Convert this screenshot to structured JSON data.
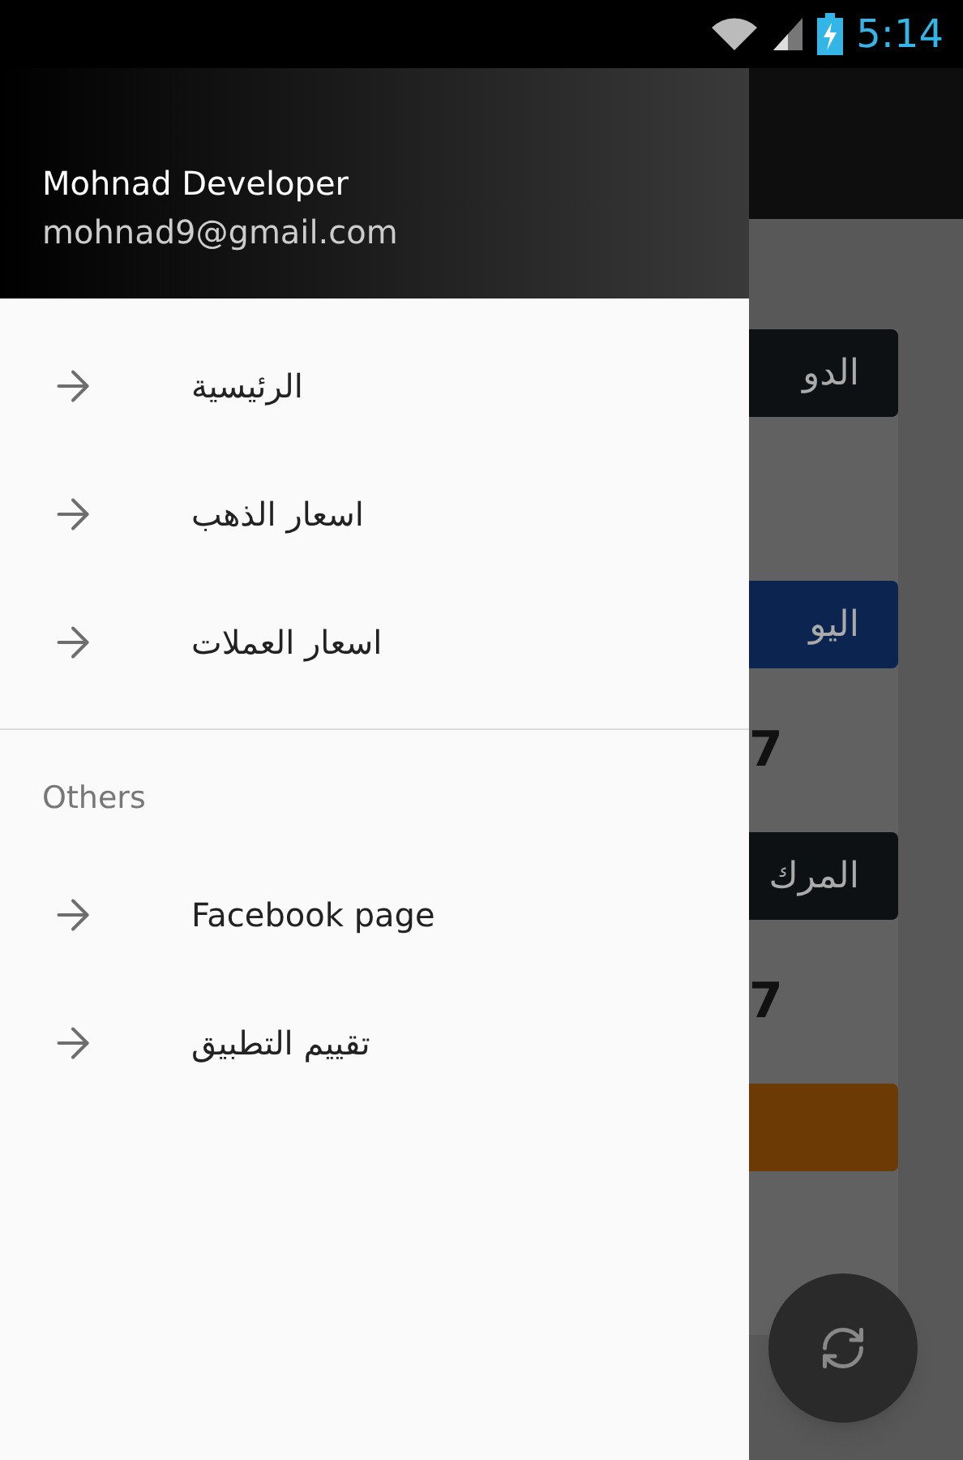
{
  "status_bar": {
    "time": "5:14"
  },
  "background": {
    "cards": [
      {
        "label": "الدو",
        "color": "#0d1114"
      },
      {
        "label": "اليو",
        "color": "#0c2550",
        "value": "7"
      },
      {
        "label": "المرك",
        "color": "#0d1114",
        "value": "7"
      },
      {
        "color": "#6b3a05"
      }
    ]
  },
  "drawer": {
    "user_name": "Mohnad Developer",
    "email": "mohnad9@gmail.com",
    "items": [
      {
        "label": "الرئيسية"
      },
      {
        "label": "اسعار الذهب"
      },
      {
        "label": "اسعار العملات"
      }
    ],
    "others": {
      "title": "Others",
      "items": [
        {
          "label": "Facebook page"
        },
        {
          "label": "تقييم التطبيق"
        }
      ]
    }
  }
}
